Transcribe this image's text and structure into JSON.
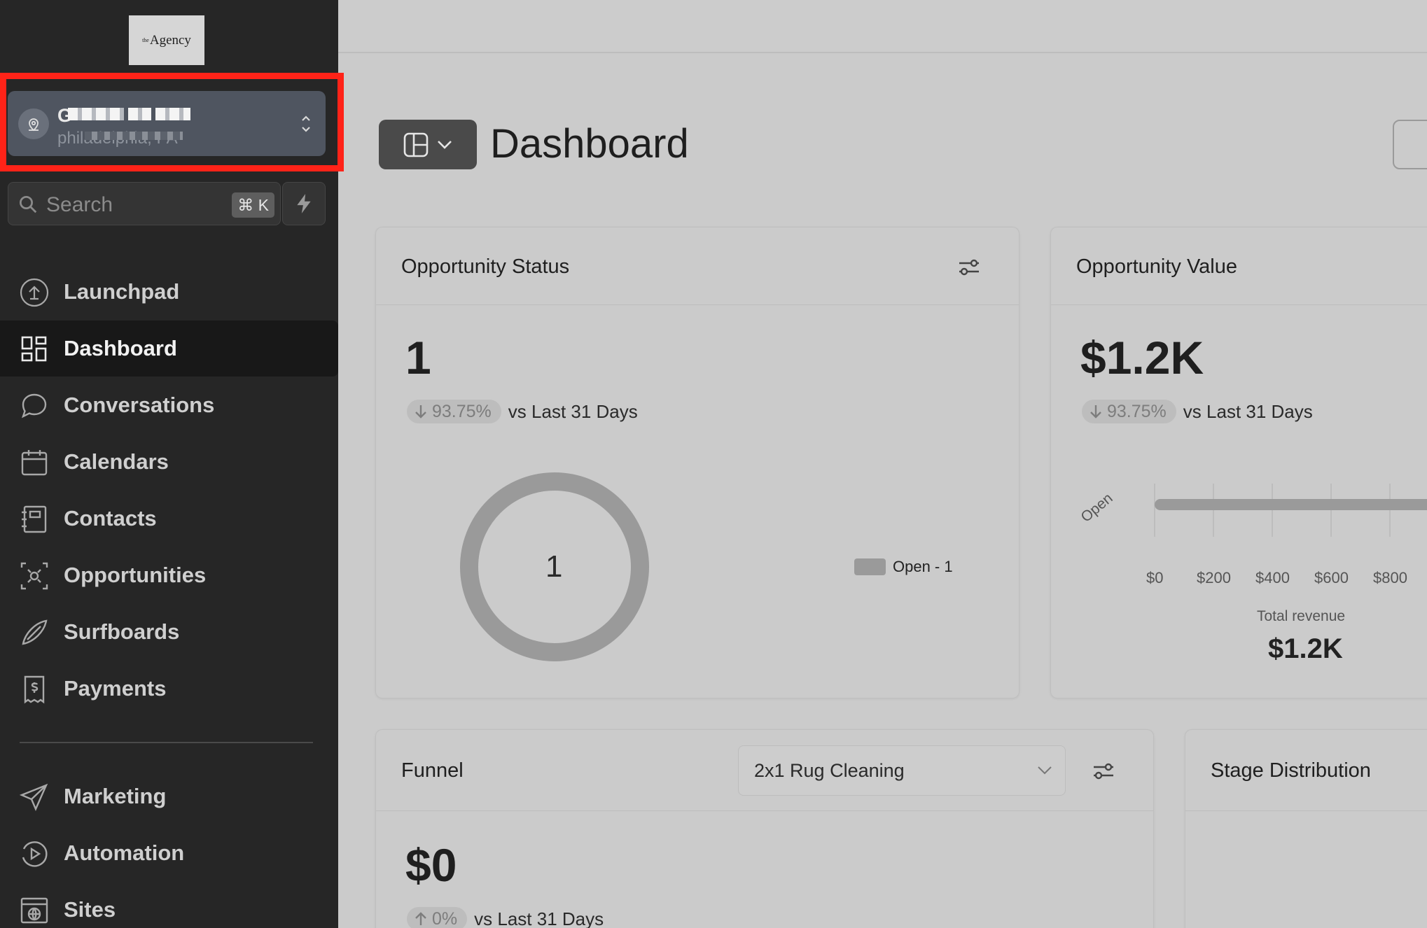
{
  "logo": {
    "prefix": "the",
    "name": "Agency"
  },
  "location": {
    "name_initial": "G",
    "subtitle": "philadelphia, PA"
  },
  "search": {
    "placeholder": "Search",
    "shortcut": "⌘ K"
  },
  "nav": {
    "items": [
      {
        "label": "Launchpad",
        "icon": "launchpad-icon"
      },
      {
        "label": "Dashboard",
        "icon": "dashboard-icon",
        "active": true
      },
      {
        "label": "Conversations",
        "icon": "chat-bubble-icon"
      },
      {
        "label": "Calendars",
        "icon": "calendar-icon"
      },
      {
        "label": "Contacts",
        "icon": "contacts-icon"
      },
      {
        "label": "Opportunities",
        "icon": "opportunities-icon"
      },
      {
        "label": "Surfboards",
        "icon": "surfboard-icon"
      },
      {
        "label": "Payments",
        "icon": "payments-icon"
      }
    ],
    "secondary": [
      {
        "label": "Marketing",
        "icon": "send-icon"
      },
      {
        "label": "Automation",
        "icon": "automation-icon"
      },
      {
        "label": "Sites",
        "icon": "sites-icon"
      }
    ]
  },
  "page": {
    "title": "Dashboard"
  },
  "opportunity_status": {
    "title": "Opportunity Status",
    "value": "1",
    "delta": "93.75%",
    "delta_direction": "down",
    "compare_label": "vs Last 31 Days",
    "donut_center": "1",
    "legend": "Open - 1"
  },
  "opportunity_value": {
    "title": "Opportunity Value",
    "value": "$1.2K",
    "delta": "93.75%",
    "delta_direction": "down",
    "compare_label": "vs Last 31 Days",
    "total_label": "Total revenue",
    "total_value": "$1.2K"
  },
  "funnel": {
    "title": "Funnel",
    "selected_pipeline": "2x1 Rug Cleaning",
    "value": "$0",
    "delta": "0%",
    "delta_direction": "up",
    "compare_label": "vs Last 31 Days"
  },
  "stage_distribution": {
    "title": "Stage Distribution"
  },
  "colors": {
    "sidebar": "#262626",
    "active_nav": "#181818",
    "highlight": "#ff2318",
    "background": "#cbcbcb",
    "chart_gray": "#9a9a9a"
  },
  "chart_data": [
    {
      "type": "pie",
      "title": "Opportunity Status",
      "categories": [
        "Open"
      ],
      "values": [
        1
      ],
      "donut": true,
      "center_label": "1"
    },
    {
      "type": "bar",
      "orientation": "horizontal",
      "title": "Opportunity Value",
      "categories": [
        "Open"
      ],
      "values": [
        1200
      ],
      "x_ticks": [
        "$0",
        "$200",
        "$400",
        "$600",
        "$800"
      ],
      "xlim": [
        0,
        1000
      ]
    }
  ]
}
